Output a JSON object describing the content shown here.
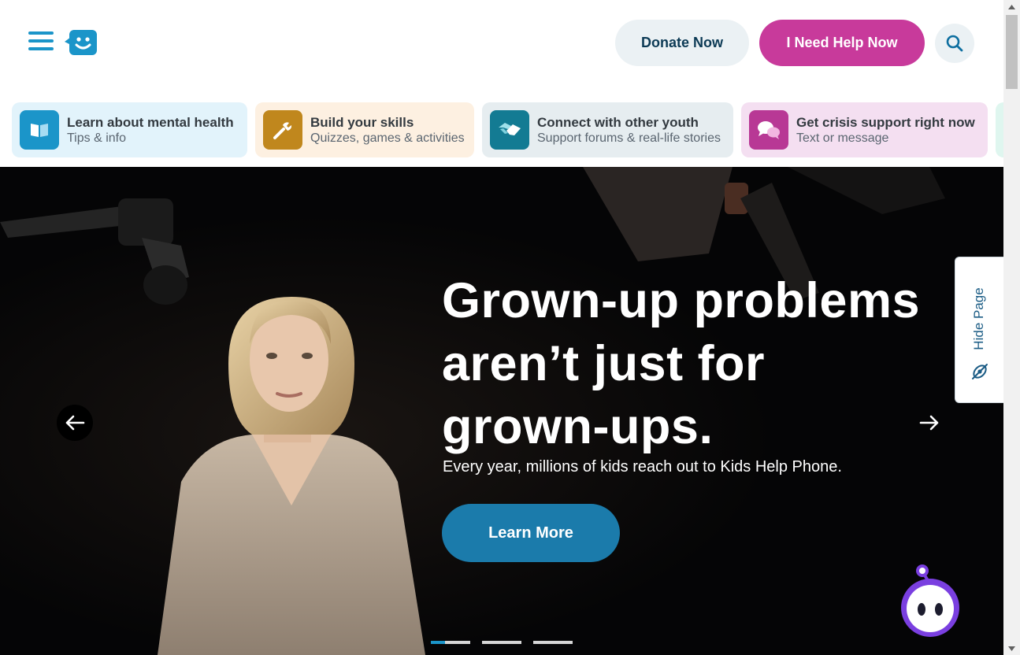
{
  "header": {
    "menu_icon": "hamburger-menu-icon",
    "logo_icon": "smiley-chat-bubble-logo",
    "donate_label": "Donate Now",
    "help_label": "I Need Help Now",
    "search_icon": "search-icon"
  },
  "categories": [
    {
      "title": "Learn about mental health",
      "subtitle": "Tips & info",
      "icon": "book-icon",
      "bg": "#e2f3fb",
      "icon_bg": "#1b95c9"
    },
    {
      "title": "Build your skills",
      "subtitle": "Quizzes, games & activities",
      "icon": "wrench-icon",
      "bg": "#fdf0e1",
      "icon_bg": "#c0871d"
    },
    {
      "title": "Connect with other youth",
      "subtitle": "Support forums & real-life stories",
      "icon": "handshake-icon",
      "bg": "#e6edf0",
      "icon_bg": "#137b93"
    },
    {
      "title": "Get crisis support right now",
      "subtitle": "Text or message",
      "icon": "chat-bubbles-icon",
      "bg": "#f4dff1",
      "icon_bg": "#b83895"
    }
  ],
  "hero": {
    "title": "Grown-up problems aren’t just for grown-ups.",
    "subtitle": "Every year, millions of kids reach out to Kids Help Phone.",
    "cta_label": "Learn More",
    "slide_count": 3,
    "active_slide": 1,
    "active_progress": 0.35
  },
  "hide_page": {
    "label": "Hide Page",
    "icon": "eye-slash-icon"
  },
  "chat_bot": {
    "icon": "robot-chat-icon"
  },
  "colors": {
    "brand_blue": "#1b95c9",
    "help_pink": "#c83a9b",
    "cta_blue": "#1b7bab",
    "donate_bg": "#ebf1f4"
  }
}
